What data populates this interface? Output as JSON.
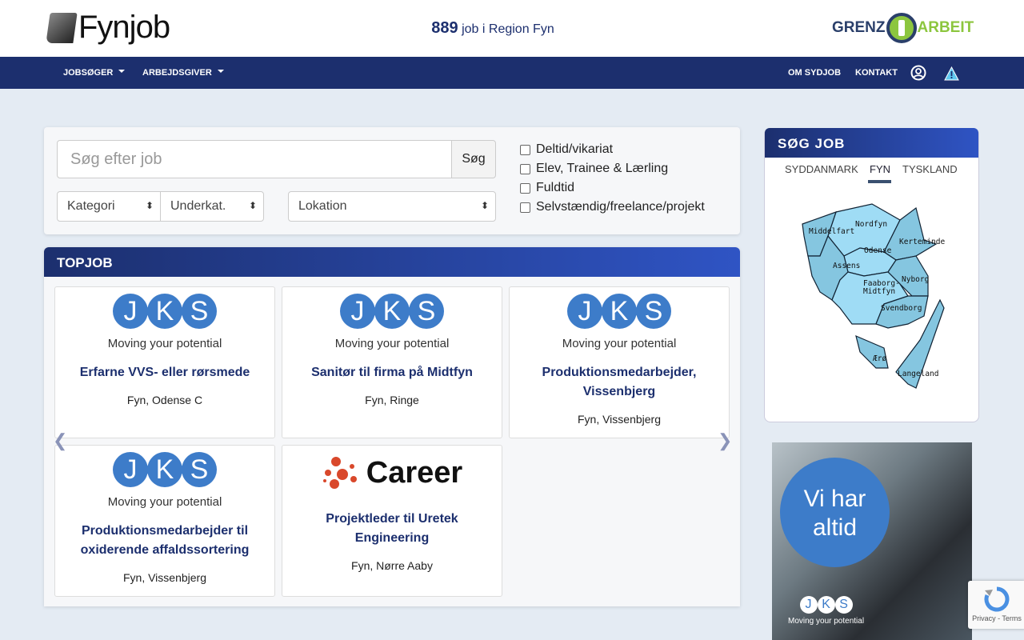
{
  "header": {
    "logo_text": "Fynjob",
    "job_count": "889",
    "job_count_suffix": " job i Region Fyn",
    "partner_left": "GRENZ",
    "partner_right": "ARBEIT"
  },
  "nav": {
    "left": [
      "JOBSØGER",
      "ARBEJDSGIVER"
    ],
    "right": [
      "OM SYDJOB",
      "KONTAKT"
    ]
  },
  "search": {
    "placeholder": "Søg efter job",
    "button": "Søg",
    "category": "Kategori",
    "subcategory": "Underkat.",
    "location": "Lokation",
    "checkboxes": [
      "Deltid/vikariat",
      "Elev, Trainee & Lærling",
      "Fuldtid",
      "Selvstændig/freelance/projekt"
    ]
  },
  "topjob": {
    "title": "TOPJOB",
    "jobs": [
      {
        "company": "JKS",
        "tagline": "Moving your potential",
        "title": "Erfarne VVS- eller rørsmede",
        "location": "Fyn, Odense C"
      },
      {
        "company": "JKS",
        "tagline": "Moving your potential",
        "title": "Sanitør til firma på Midtfyn",
        "location": "Fyn, Ringe"
      },
      {
        "company": "JKS",
        "tagline": "Moving your potential",
        "title": "Produktionsmedarbejder, Vissenbjerg",
        "location": "Fyn, Vissenbjerg"
      },
      {
        "company": "JKS",
        "tagline": "Moving your potential",
        "title": "Produktionsmedarbejder til oxiderende affaldssortering",
        "location": "Fyn, Vissenbjerg"
      },
      {
        "company": "Career",
        "tagline": "",
        "title": "Projektleder til Uretek Engineering",
        "location": "Fyn, Nørre Aaby"
      }
    ]
  },
  "sidebar": {
    "title": "SØG JOB",
    "tabs": [
      "SYDDANMARK",
      "FYN",
      "TYSKLAND"
    ],
    "active_tab": "FYN",
    "regions": [
      "Nordfyn",
      "Middelfart",
      "Kerteminde",
      "Odense",
      "Assens",
      "Nyborg",
      "Faaborg-",
      "Midtfyn",
      "Svendborg",
      "Ærø",
      "Langeland"
    ]
  },
  "ad": {
    "headline_1": "Vi har",
    "headline_2": "altid",
    "logo": "JKS",
    "tagline": "Moving your potential"
  },
  "recaptcha": {
    "text": "Privacy - Terms"
  }
}
